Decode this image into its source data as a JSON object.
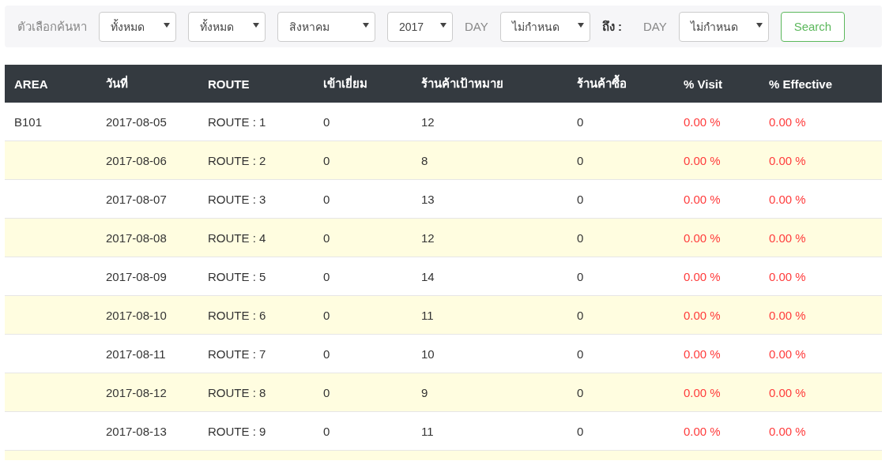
{
  "filters": [
    {
      "kind": "label",
      "text": "ตัวเลือกค้นหา"
    },
    {
      "kind": "select",
      "value": "ทั้งหมด"
    },
    {
      "kind": "select",
      "value": "ทั้งหมด"
    },
    {
      "kind": "select",
      "value": "สิงหาคม"
    },
    {
      "kind": "select",
      "value": "2017"
    },
    {
      "kind": "label",
      "text": "DAY"
    },
    {
      "kind": "select",
      "value": "ไม่กำหนด"
    },
    {
      "kind": "strong",
      "text": "ถึง :"
    },
    {
      "kind": "label",
      "text": "DAY"
    },
    {
      "kind": "select",
      "value": "ไม่กำหนด"
    },
    {
      "kind": "button",
      "text": "Search"
    }
  ],
  "table": {
    "columns": [
      "AREA",
      "วันที่",
      "ROUTE",
      "เข้าเยี่ยม",
      "ร้านค้าเป้าหมาย",
      "ร้านค้าซื้อ",
      "% Visit",
      "% Effective"
    ],
    "rows": [
      [
        "B101",
        "2017-08-05",
        "ROUTE : 1",
        "0",
        "12",
        "0",
        "0.00 %",
        "0.00 %"
      ],
      [
        "",
        "2017-08-06",
        "ROUTE : 2",
        "0",
        "8",
        "0",
        "0.00 %",
        "0.00 %"
      ],
      [
        "",
        "2017-08-07",
        "ROUTE : 3",
        "0",
        "13",
        "0",
        "0.00 %",
        "0.00 %"
      ],
      [
        "",
        "2017-08-08",
        "ROUTE : 4",
        "0",
        "12",
        "0",
        "0.00 %",
        "0.00 %"
      ],
      [
        "",
        "2017-08-09",
        "ROUTE : 5",
        "0",
        "14",
        "0",
        "0.00 %",
        "0.00 %"
      ],
      [
        "",
        "2017-08-10",
        "ROUTE : 6",
        "0",
        "11",
        "0",
        "0.00 %",
        "0.00 %"
      ],
      [
        "",
        "2017-08-11",
        "ROUTE : 7",
        "0",
        "10",
        "0",
        "0.00 %",
        "0.00 %"
      ],
      [
        "",
        "2017-08-12",
        "ROUTE : 8",
        "0",
        "9",
        "0",
        "0.00 %",
        "0.00 %"
      ],
      [
        "",
        "2017-08-13",
        "ROUTE : 9",
        "0",
        "11",
        "0",
        "0.00 %",
        "0.00 %"
      ]
    ]
  }
}
